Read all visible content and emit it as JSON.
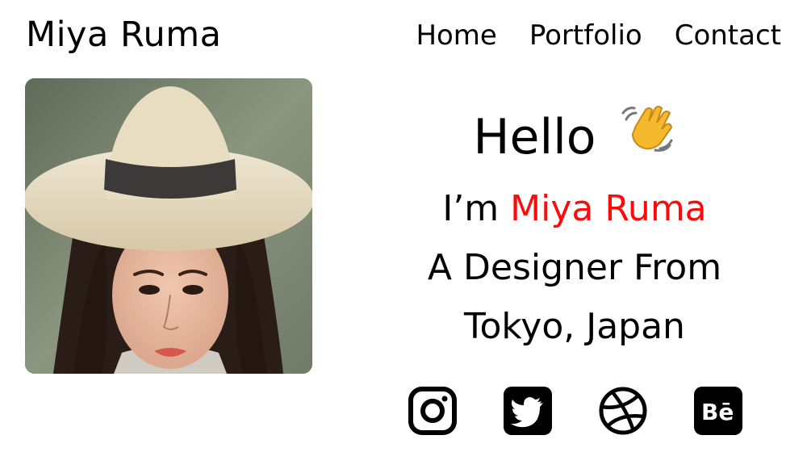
{
  "header": {
    "brand": "Miya Ruma",
    "nav": [
      "Home",
      "Portfolio",
      "Contact"
    ]
  },
  "hero": {
    "greeting": "Hello",
    "im_prefix": "I’m ",
    "name": "Miya Ruma",
    "line3": "A Designer From",
    "line4": "Tokyo, Japan"
  },
  "socials": [
    "instagram-icon",
    "twitter-icon",
    "dribbble-icon",
    "behance-icon"
  ],
  "colors": {
    "accent": "#ff0a0a",
    "text": "#000000"
  }
}
